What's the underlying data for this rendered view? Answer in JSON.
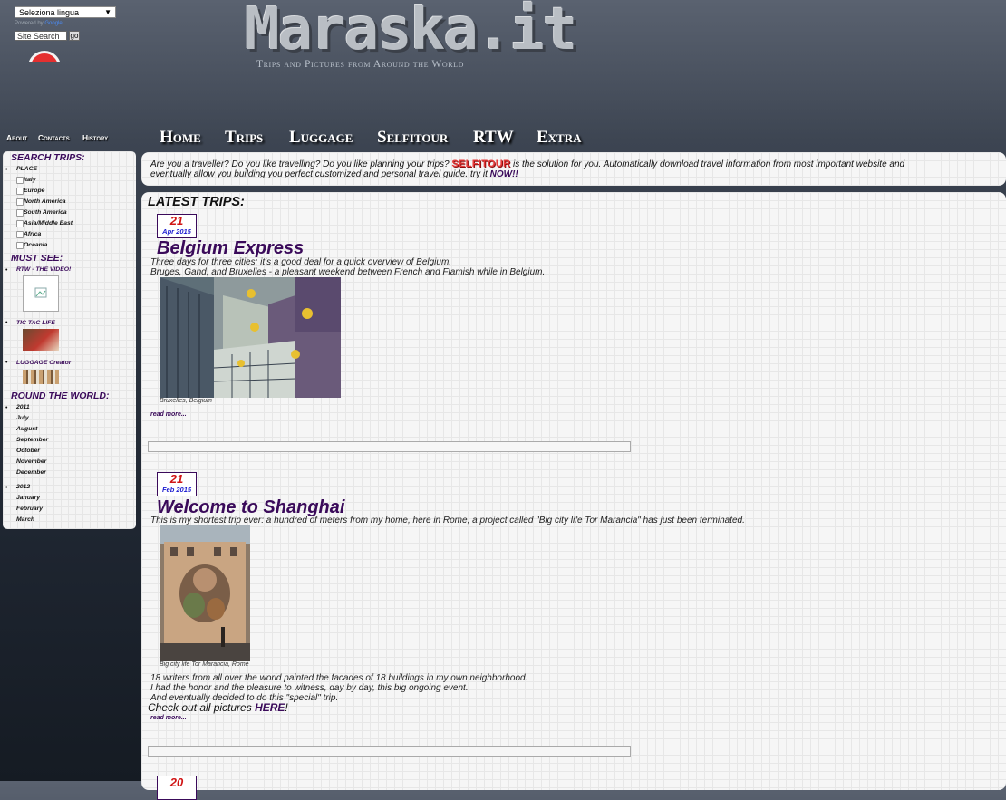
{
  "language": {
    "label": "Seleziona lingua",
    "powered_by": "Powered by",
    "google": "Google"
  },
  "search": {
    "value": "Site Search",
    "button": "go"
  },
  "logo": {
    "text": "Maraska.it",
    "tagline": "Trips and Pictures from Around the World"
  },
  "small_nav": [
    "About",
    "Contacts",
    "History"
  ],
  "main_nav": [
    "Home",
    "Trips",
    "Luggage",
    "Selfitour",
    "RTW",
    "Extra"
  ],
  "sidebar": {
    "search_heading": "SEARCH TRIPS:",
    "place_label": "PLACE",
    "places": [
      "Italy",
      "Europe",
      "North America",
      "South America",
      "Asia/Middle East",
      "Africa",
      "Oceania"
    ],
    "must_see_heading": "MUST SEE:",
    "must_see": [
      "RTW - THE VIDEO!",
      "TIC TAC LIFE",
      "LUGGAGE Creator"
    ],
    "rtw_heading": "ROUND THE WORLD:",
    "years": [
      {
        "year": "2011",
        "months": [
          "July",
          "August",
          "September",
          "October",
          "November",
          "December"
        ]
      },
      {
        "year": "2012",
        "months": [
          "January",
          "February",
          "March"
        ]
      }
    ]
  },
  "intro": {
    "line1_a": "Are you a traveller? Do you like travelling? Do you like planning your trips?",
    "brand": "SELFITOUR",
    "line1_b": "is the solution for you. Automatically download travel information from most important website and",
    "line2": "eventually allow you building you perfect customized and personal travel guide. try it",
    "cta": "NOW!!"
  },
  "latest_heading": "LATEST TRIPS:",
  "posts": [
    {
      "day": "21",
      "month": "Apr 2015",
      "title": "Belgium Express",
      "text": [
        "Three days for three cities: it's a good deal for a quick overview of Belgium.",
        "Bruges, Gand, and Bruxelles - a pleasant weekend between French and Flamish while in Belgium."
      ],
      "caption": "Bruxelles, Belgium",
      "read_more": "read more..."
    },
    {
      "day": "21",
      "month": "Feb 2015",
      "title": "Welcome to Shanghai",
      "text": [
        "This is my shortest trip ever: a hundred of meters from my home, here in Rome, a project called \"Big city life Tor Marancia\" has just been terminated."
      ],
      "caption": "Big city life Tor Marancia, Rome",
      "text2": [
        "18 writers from all over the world painted the facades of 18 buildings in my own neighborhood.",
        "I had the honor and the pleasure to witness, day by day, this big ongoing event.",
        "And eventually decided to do this \"special\" trip."
      ],
      "pictures_a": "Check out all pictures",
      "pictures_link": "HERE",
      "pictures_b": "!",
      "read_more": "read more..."
    },
    {
      "day": "20"
    }
  ]
}
